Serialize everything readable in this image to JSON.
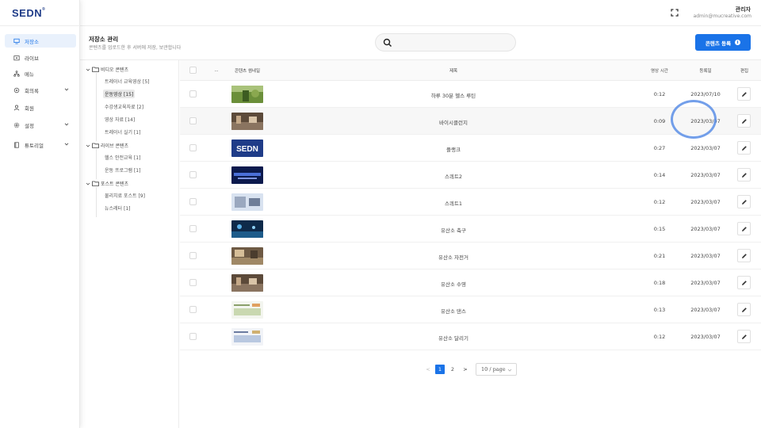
{
  "app": {
    "logo": "SEDN"
  },
  "sidebar": {
    "items": [
      {
        "label": "저장소",
        "icon": "monitor-icon",
        "active": true
      },
      {
        "label": "라이브",
        "icon": "live-icon"
      },
      {
        "label": "메뉴",
        "icon": "menu-tree-icon"
      },
      {
        "label": "회의록",
        "icon": "gear-doc-icon",
        "expandable": true
      },
      {
        "label": "회원",
        "icon": "user-icon"
      },
      {
        "label": "설정",
        "icon": "gear-icon",
        "expandable": true
      },
      {
        "label": "튜토리얼",
        "icon": "book-icon",
        "expandable": true
      }
    ]
  },
  "header": {
    "user_name": "관리자",
    "user_email": "admin@mucreative.com",
    "fullscreen_icon": "fullscreen-icon"
  },
  "page": {
    "title": "저장소 관리",
    "subtitle": "콘텐츠를 업로드한 후 서버에 저장, 보관합니다",
    "search_placeholder": "",
    "register_label": "콘텐츠 등록",
    "register_info": "i"
  },
  "tree": [
    {
      "label": "비디오 콘텐츠",
      "children": [
        {
          "label": "트레이너 교육영상 [5]"
        },
        {
          "label": "운동영상 [15]",
          "selected": true
        },
        {
          "label": "수강생교육자료 [2]"
        },
        {
          "label": "영상 자료 [14]"
        },
        {
          "label": "트레이너 실기 [1]"
        }
      ]
    },
    {
      "label": "라이브 콘텐츠",
      "children": [
        {
          "label": "헬스 안전교육 [1]"
        },
        {
          "label": "운동 프로그램 [1]"
        }
      ]
    },
    {
      "label": "포스트 콘텐츠",
      "children": [
        {
          "label": "물리치료 포스트 [9]"
        },
        {
          "label": "뉴스레터 [1]"
        }
      ]
    }
  ],
  "table": {
    "columns": [
      "...",
      "콘텐츠 썸네일",
      "제목",
      "영상 시간",
      "등록일",
      "편집"
    ],
    "rows": [
      {
        "title": "하루 30분 헬스 루틴",
        "duration": "0:12",
        "date": "2023/07/10",
        "thumb": "forest"
      },
      {
        "title": "바이시클런지",
        "duration": "0:09",
        "date": "2023/03/07",
        "thumb": "gym"
      },
      {
        "title": "플랭크",
        "duration": "0:27",
        "date": "2023/03/07",
        "thumb": "sedn"
      },
      {
        "title": "스쿼트2",
        "duration": "0:14",
        "date": "2023/03/07",
        "thumb": "camp"
      },
      {
        "title": "스쿼트1",
        "duration": "0:12",
        "date": "2023/03/07",
        "thumb": "studio"
      },
      {
        "title": "유산소 축구",
        "duration": "0:15",
        "date": "2023/03/07",
        "thumb": "stage"
      },
      {
        "title": "유산소 자전거",
        "duration": "0:21",
        "date": "2023/03/07",
        "thumb": "gym2"
      },
      {
        "title": "유산소 수영",
        "duration": "0:18",
        "date": "2023/03/07",
        "thumb": "gym"
      },
      {
        "title": "유산소 댄스",
        "duration": "0:13",
        "date": "2023/03/07",
        "thumb": "doc"
      },
      {
        "title": "유산소 달리기",
        "duration": "0:12",
        "date": "2023/03/07",
        "thumb": "doc2"
      }
    ]
  },
  "pagination": {
    "prev": "<",
    "pages": [
      "1",
      "2"
    ],
    "current": "1",
    "next": ">",
    "page_size": "10 / page"
  },
  "colors": {
    "accent": "#1a73e8",
    "logo": "#1f3c88"
  }
}
